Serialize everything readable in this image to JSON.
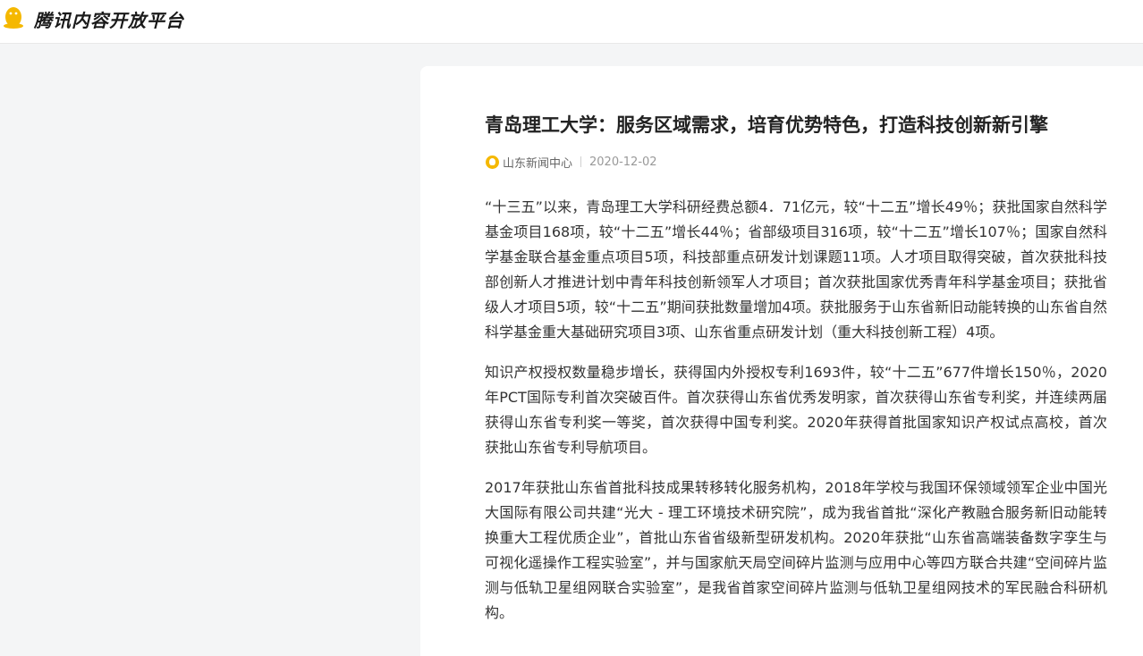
{
  "header": {
    "brand": "腾讯内容开放平台",
    "logo_icon": "penguin-icon",
    "accent_color": "#f5b800"
  },
  "article": {
    "title": "青岛理工大学：服务区域需求，培育优势特色，打造科技创新新引擎",
    "source": "山东新闻中心",
    "date": "2020-12-02",
    "paragraphs": [
      "“十三五”以来，青岛理工大学科研经费总额4．71亿元，较“十二五”增长49％；获批国家自然科学基金项目168项，较“十二五”增长44％；省部级项目316项，较“十二五”增长107％；国家自然科学基金联合基金重点项目5项，科技部重点研发计划课题11项。人才项目取得突破，首次获批科技部创新人才推进计划中青年科技创新领军人才项目；首次获批国家优秀青年科学基金项目；获批省级人才项目5项，较“十二五”期间获批数量增加4项。获批服务于山东省新旧动能转换的山东省自然科学基金重大基础研究项目3项、山东省重点研发计划（重大科技创新工程）4项。",
      "知识产权授权数量稳步增长，获得国内外授权专利1693件，较“十二五”677件增长150％，2020年PCT国际专利首次突破百件。首次获得山东省优秀发明家，首次获得山东省专利奖，并连续两届获得山东省专利奖一等奖，首次获得中国专利奖。2020年获得首批国家知识产权试点高校，首次获批山东省专利导航项目。",
      "2017年获批山东省首批科技成果转移转化服务机构，2018年学校与我国环保领域领军企业中国光大国际有限公司共建“光大 - 理工环境技术研究院”，成为我省首批“深化产教融合服务新旧动能转换重大工程优质企业”，首批山东省省级新型研发机构。2020年获批“山东省高端装备数字孪生与可视化遥操作工程实验室”，并与国家航天局空间碎片监测与应用中心等四方联合共建“空间碎片监测与低轨卫星组网联合实验室”，是我省首家空间碎片监测与低轨卫星组网技术的军民融合科研机构。"
    ]
  }
}
